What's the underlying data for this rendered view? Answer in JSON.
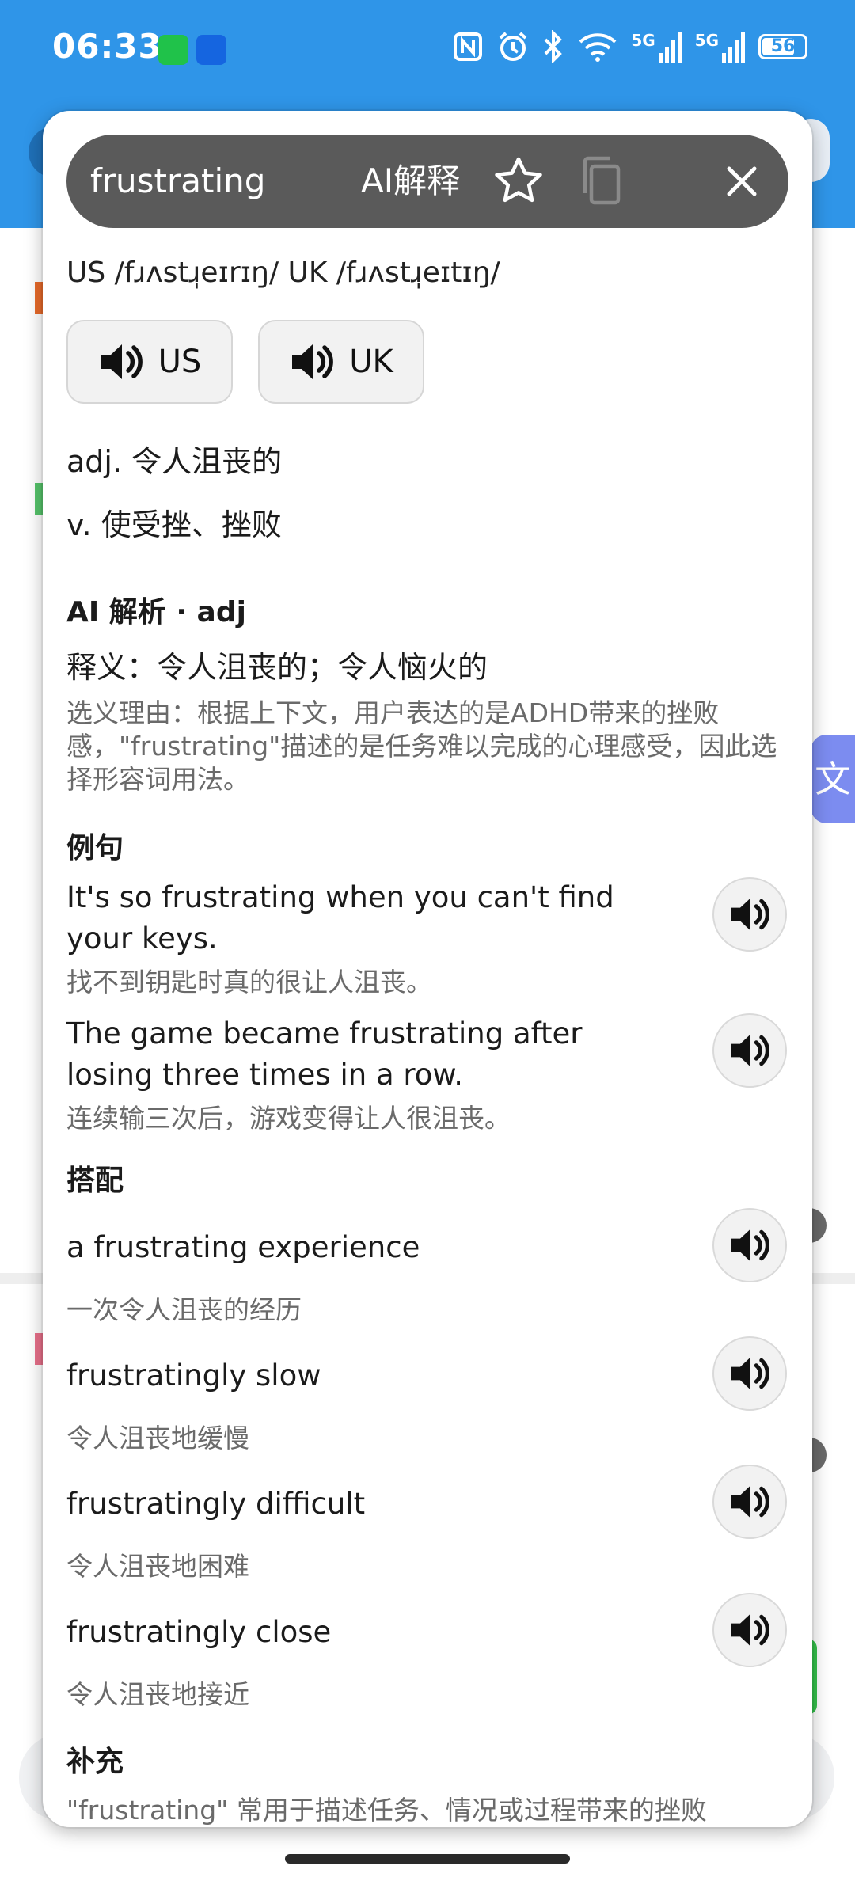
{
  "status_bar": {
    "time": "06:33",
    "network_1": "5G",
    "network_2": "5G",
    "battery": "56"
  },
  "header": {
    "word": "frustrating",
    "ai_button": "AI解释",
    "icons": [
      "star-icon",
      "copy-icon",
      "close-icon"
    ]
  },
  "phonetics": {
    "text": "US /fɹʌstɹ̩eɪrɪŋ/   UK /fɹʌstɹ̩eɪtɪŋ/",
    "us_button": "US",
    "uk_button": "UK"
  },
  "definitions": [
    "adj. 令人沮丧的",
    "v. 使受挫、挫败"
  ],
  "ai_analysis": {
    "heading": "AI 解析 · adj",
    "gloss": "释义：令人沮丧的；令人恼火的",
    "reason": "选义理由：根据上下文，用户表达的是ADHD带来的挫败感，\"frustrating\"描述的是任务难以完成的心理感受，因此选择形容词用法。"
  },
  "examples": {
    "heading": "例句",
    "items": [
      {
        "en": "It's so frustrating when you can't find your keys.",
        "zh": "找不到钥匙时真的很让人沮丧。"
      },
      {
        "en": "The game became frustrating after losing three times in a row.",
        "zh": "连续输三次后，游戏变得让人很沮丧。"
      }
    ]
  },
  "collocations": {
    "heading": "搭配",
    "items": [
      {
        "en": "a frustrating experience",
        "zh": "一次令人沮丧的经历"
      },
      {
        "en": "frustratingly slow",
        "zh": "令人沮丧地缓慢"
      },
      {
        "en": "frustratingly difficult",
        "zh": "令人沮丧地困难"
      },
      {
        "en": "frustratingly close",
        "zh": "令人沮丧地接近"
      }
    ]
  },
  "supplement": {
    "heading": "补充",
    "text": "\"frustrating\" 常用于描述任务、情况或过程带来的挫败"
  },
  "colors": {
    "accent_blue": "#2f95e8",
    "headbar": "#5a5a5a",
    "muted_text": "#6a6a6a"
  }
}
